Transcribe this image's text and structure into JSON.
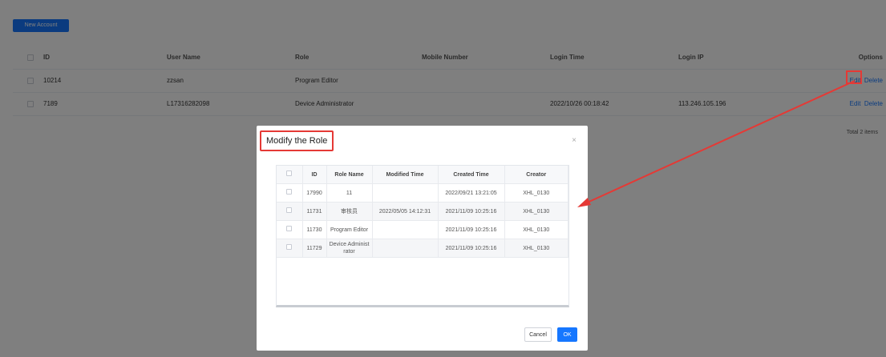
{
  "toolbar": {
    "new_account_label": "New Account"
  },
  "table": {
    "headers": {
      "id": "ID",
      "user_name": "User Name",
      "role": "Role",
      "mobile": "Mobile Number",
      "login_time": "Login Time",
      "login_ip": "Login IP",
      "options": "Options"
    },
    "rows": [
      {
        "id": "10214",
        "user_name": "zzsan",
        "role": "Program Editor",
        "mobile": "",
        "login_time": "",
        "login_ip": "",
        "edit": "Edit",
        "delete": "Delete"
      },
      {
        "id": "7189",
        "user_name": "L17316282098",
        "role": "Device Administrator",
        "mobile": "",
        "login_time": "2022/10/26 00:18:42",
        "login_ip": "113.246.105.196",
        "edit": "Edit",
        "delete": "Delete"
      }
    ],
    "total": "Total 2 items"
  },
  "dialog": {
    "title": "Modify the Role",
    "close_icon": "×",
    "headers": {
      "id": "ID",
      "role_name": "Role Name",
      "modified_time": "Modified Time",
      "created_time": "Created Time",
      "creator": "Creator"
    },
    "rows": [
      {
        "id": "17990",
        "role_name": "11",
        "modified_time": "",
        "created_time": "2022/09/21 13:21:05",
        "creator": "XHL_0130"
      },
      {
        "id": "11731",
        "role_name": "审核员",
        "modified_time": "2022/05/05 14:12:31",
        "created_time": "2021/11/09 10:25:16",
        "creator": "XHL_0130"
      },
      {
        "id": "11730",
        "role_name": "Program Editor",
        "modified_time": "",
        "created_time": "2021/11/09 10:25:16",
        "creator": "XHL_0130"
      },
      {
        "id": "11729",
        "role_name": "Device Administrator",
        "modified_time": "",
        "created_time": "2021/11/09 10:25:16",
        "creator": "XHL_0130"
      }
    ],
    "cancel_label": "Cancel",
    "ok_label": "OK"
  },
  "colors": {
    "accent": "#1677ff",
    "highlight": "#e53935",
    "overlay": "rgba(0,0,0,0.5)"
  }
}
